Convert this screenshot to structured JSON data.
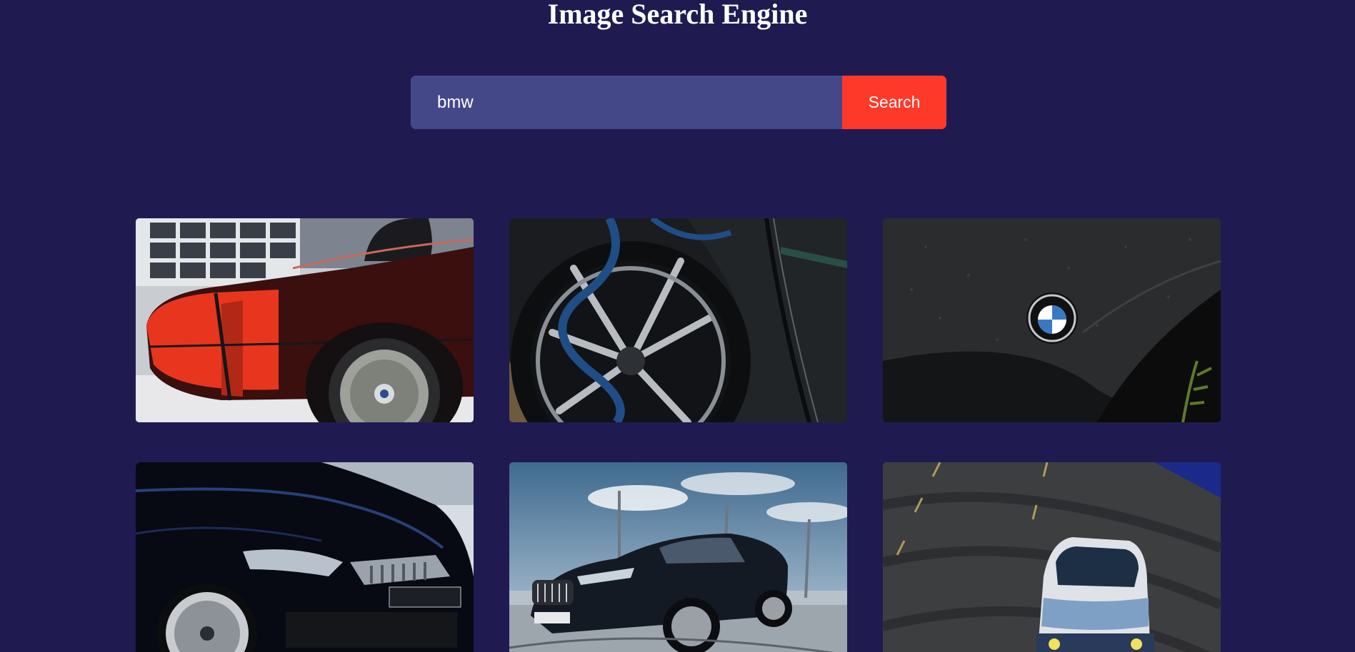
{
  "header": {
    "title": "Image Search Engine"
  },
  "search": {
    "query": "bmw",
    "button_label": "Search"
  },
  "colors": {
    "background": "#1f1b51",
    "input_background": "#454888",
    "button_background": "#ff3929",
    "text": "#ffffff"
  },
  "results": [
    {
      "subject": "red-classic-car-photo"
    },
    {
      "subject": "charging-car-wheel-photo"
    },
    {
      "subject": "bmw-emblem-photo"
    },
    {
      "subject": "black-bmw-m4-photo"
    },
    {
      "subject": "black-bmw-sedan-photo"
    },
    {
      "subject": "drifting-bmw-photo"
    }
  ]
}
